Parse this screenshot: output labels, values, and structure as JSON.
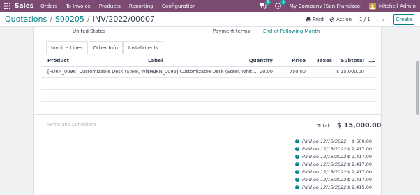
{
  "nav": {
    "app_name": "Sales",
    "menu": [
      "Orders",
      "To Invoice",
      "Products",
      "Reporting",
      "Configuration"
    ],
    "chat_badge": "5",
    "activity_badge": "1",
    "company": "My Company (San Francisco)",
    "user": "Mitchell Admin"
  },
  "control_panel": {
    "breadcrumbs": [
      "Quotations",
      "S00205",
      "INV/2022/00007"
    ],
    "print_label": "Print",
    "action_label": "Action",
    "pager": "1 / 1",
    "create_label": "Create"
  },
  "form": {
    "country": "United States",
    "payment_terms_label": "Payment terms",
    "payment_terms_value": "End of Following Month",
    "tabs": [
      "Invoice Lines",
      "Other Info",
      "Installments"
    ],
    "active_tab": "Invoice Lines",
    "columns": {
      "product": "Product",
      "label": "Label",
      "quantity": "Quantity",
      "price": "Price",
      "taxes": "Taxes",
      "subtotal": "Subtotal"
    },
    "lines": [
      {
        "product": "[FURN_0096] Customizable Desk (Steel, White)",
        "label": "[FURN_0096] Customizable Desk (Steel, Whit...",
        "quantity": "20.00",
        "price": "750.00",
        "taxes": "",
        "subtotal": "$ 15,000.00"
      }
    ],
    "terms_placeholder": "Terms and Conditions",
    "total_label": "Total:",
    "total_value": "$ 15,000.00",
    "payments": [
      {
        "text": "Paid on 12/15/2022",
        "amount": "$ 500.00"
      },
      {
        "text": "Paid on 12/15/2022",
        "amount": "$ 2,417.00"
      },
      {
        "text": "Paid on 12/15/2022",
        "amount": "$ 2,417.00"
      },
      {
        "text": "Paid on 12/15/2022",
        "amount": "$ 2,417.00"
      },
      {
        "text": "Paid on 12/15/2022",
        "amount": "$ 2,417.00"
      },
      {
        "text": "Paid on 12/15/2022",
        "amount": "$ 2,417.00"
      },
      {
        "text": "Paid on 12/15/2022",
        "amount": "$ 2,415.00"
      }
    ]
  },
  "colors": {
    "nav_bg": "#7c4b73",
    "accent": "#017e84"
  }
}
